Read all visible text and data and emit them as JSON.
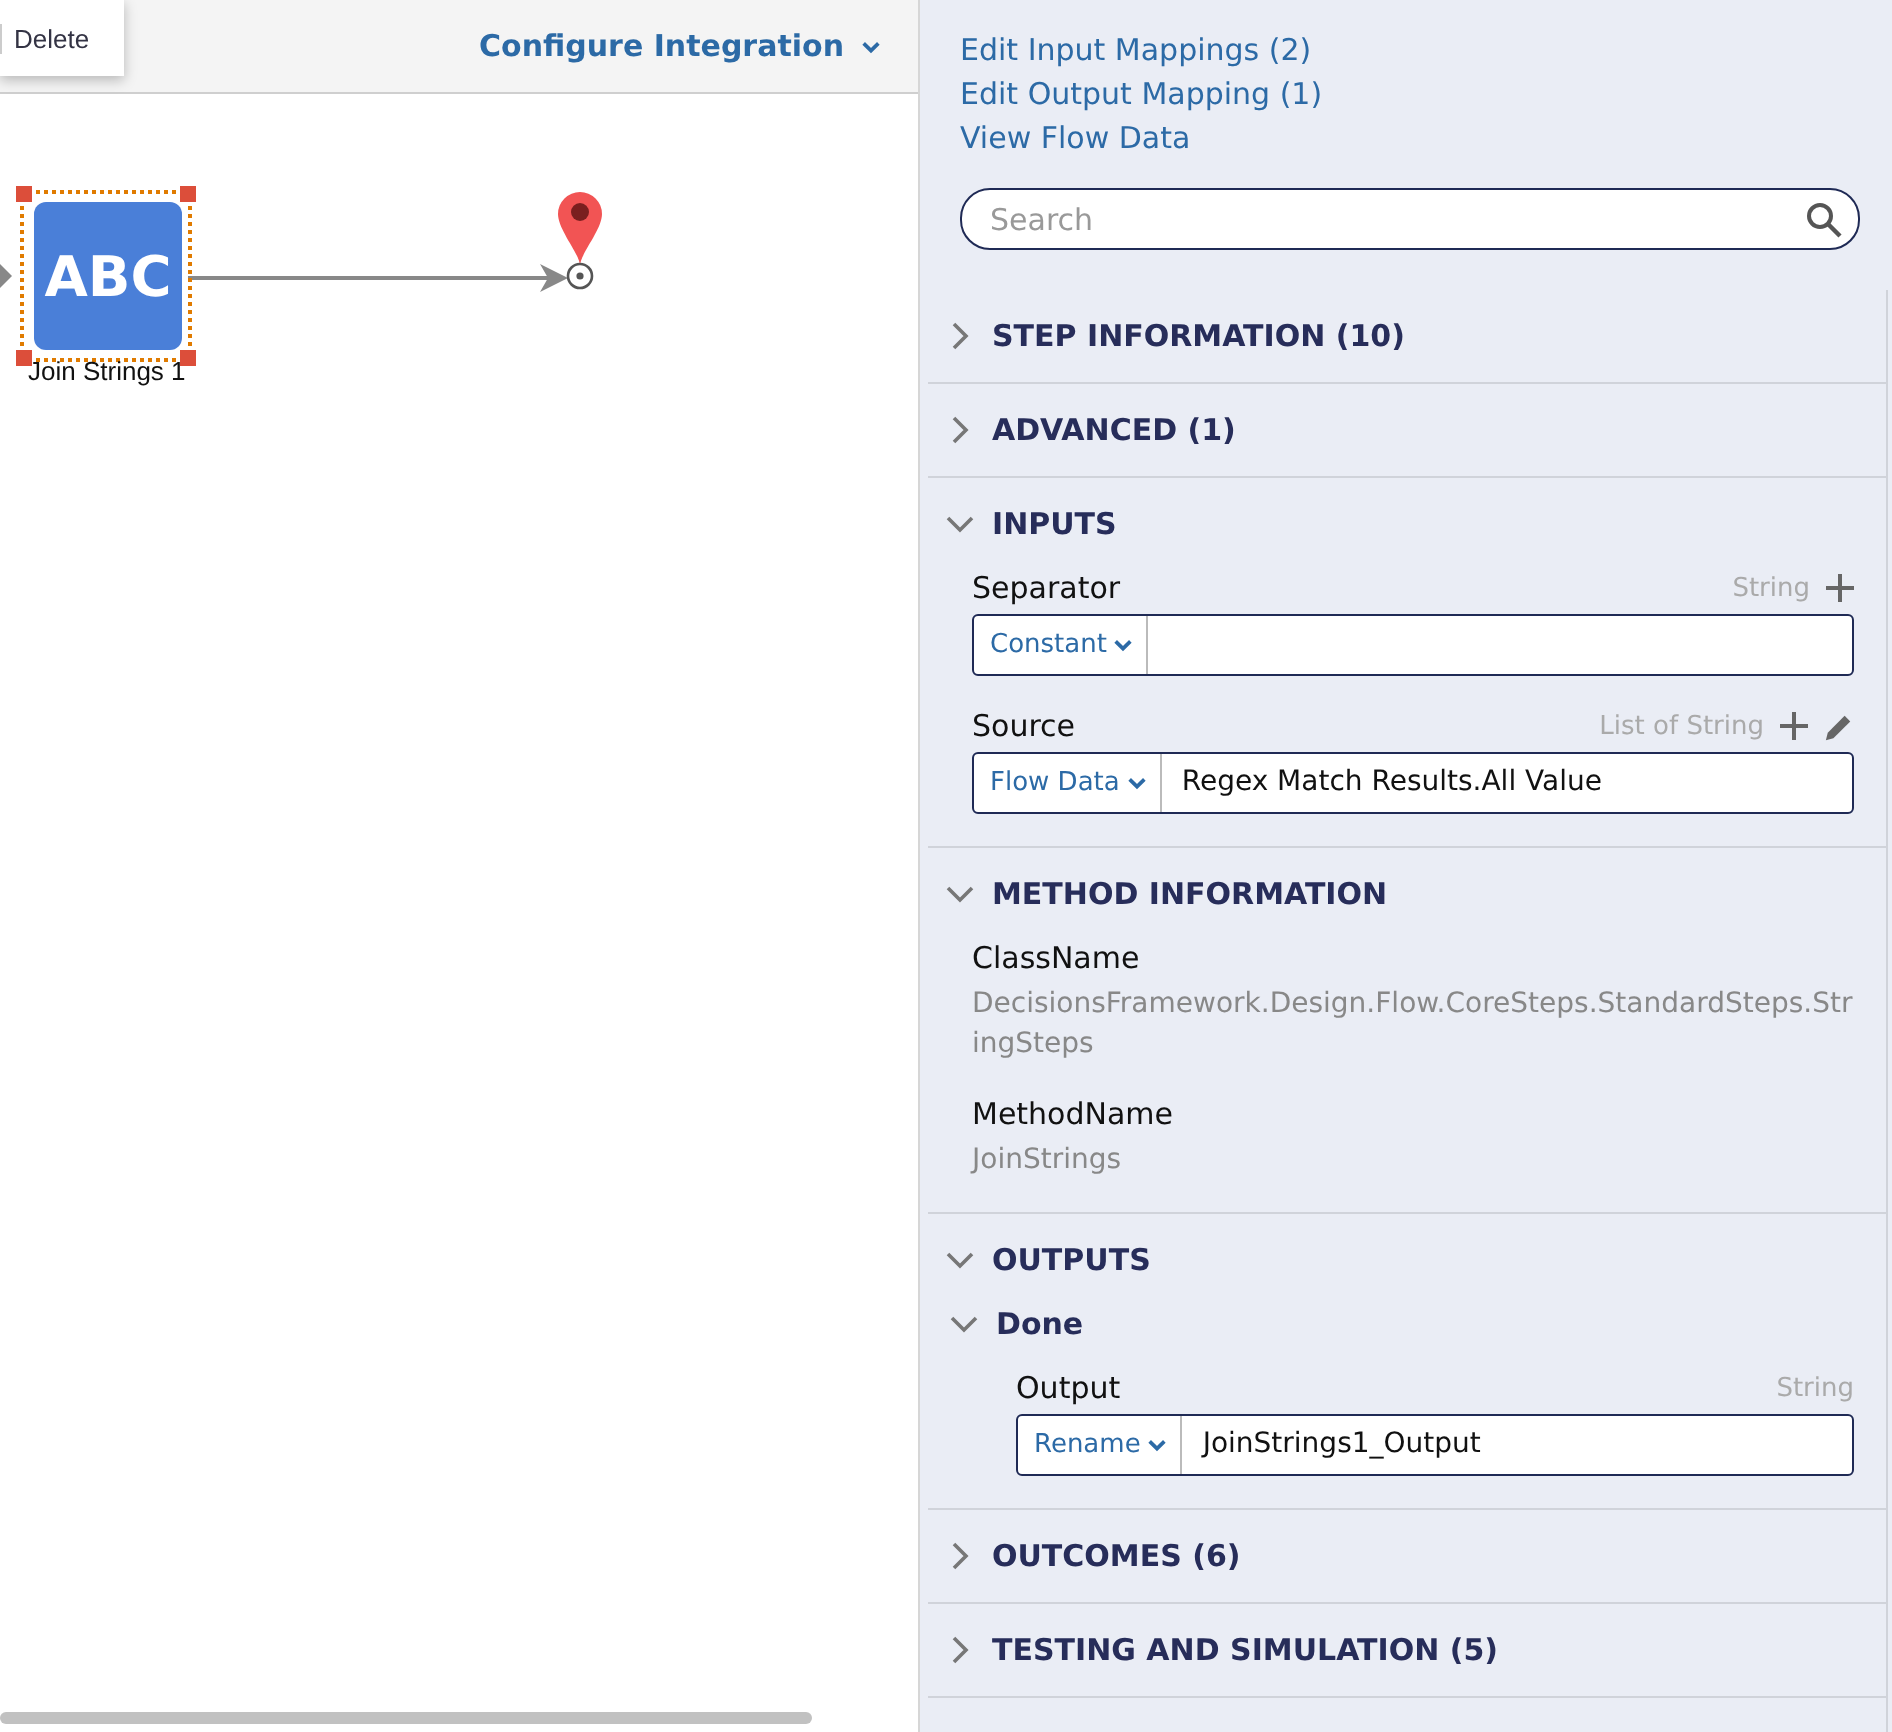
{
  "toolbar": {
    "delete": "Delete",
    "configure": "Configure Integration"
  },
  "canvas": {
    "node": {
      "label": "ABC",
      "caption": "Join Strings 1",
      "selected": true
    }
  },
  "links": [
    "Edit Input Mappings (2)",
    "Edit Output Mapping (1)",
    "View Flow Data"
  ],
  "search": {
    "placeholder": "Search"
  },
  "sections": [
    {
      "title": "STEP INFORMATION (10)",
      "expanded": false
    },
    {
      "title": "ADVANCED (1)",
      "expanded": false
    },
    {
      "kind": "inputs",
      "title": "INPUTS",
      "expanded": true,
      "fields": [
        {
          "label": "Separator",
          "type": "String",
          "mode": "Constant",
          "can_add": true
        },
        {
          "label": "Source",
          "type": "List of String",
          "mode": "Flow Data",
          "value": "Regex Match Results.All Value",
          "can_add": true,
          "can_edit": true
        }
      ]
    },
    {
      "kind": "info",
      "title": "METHOD INFORMATION",
      "expanded": true,
      "items": [
        {
          "label": "ClassName",
          "value": "DecisionsFramework.Design.Flow.CoreSteps.StandardSteps.StringSteps"
        },
        {
          "label": "MethodName",
          "value": "JoinStrings"
        }
      ]
    },
    {
      "kind": "outputs",
      "title": "OUTPUTS",
      "expanded": true,
      "groups": [
        {
          "title": "Done",
          "expanded": true,
          "fields": [
            {
              "label": "Output",
              "type": "String",
              "mode": "Rename",
              "value": "JoinStrings1_Output"
            }
          ]
        }
      ]
    },
    {
      "title": "OUTCOMES (6)",
      "expanded": false
    },
    {
      "title": "TESTING AND SIMULATION (5)",
      "expanded": false
    }
  ]
}
